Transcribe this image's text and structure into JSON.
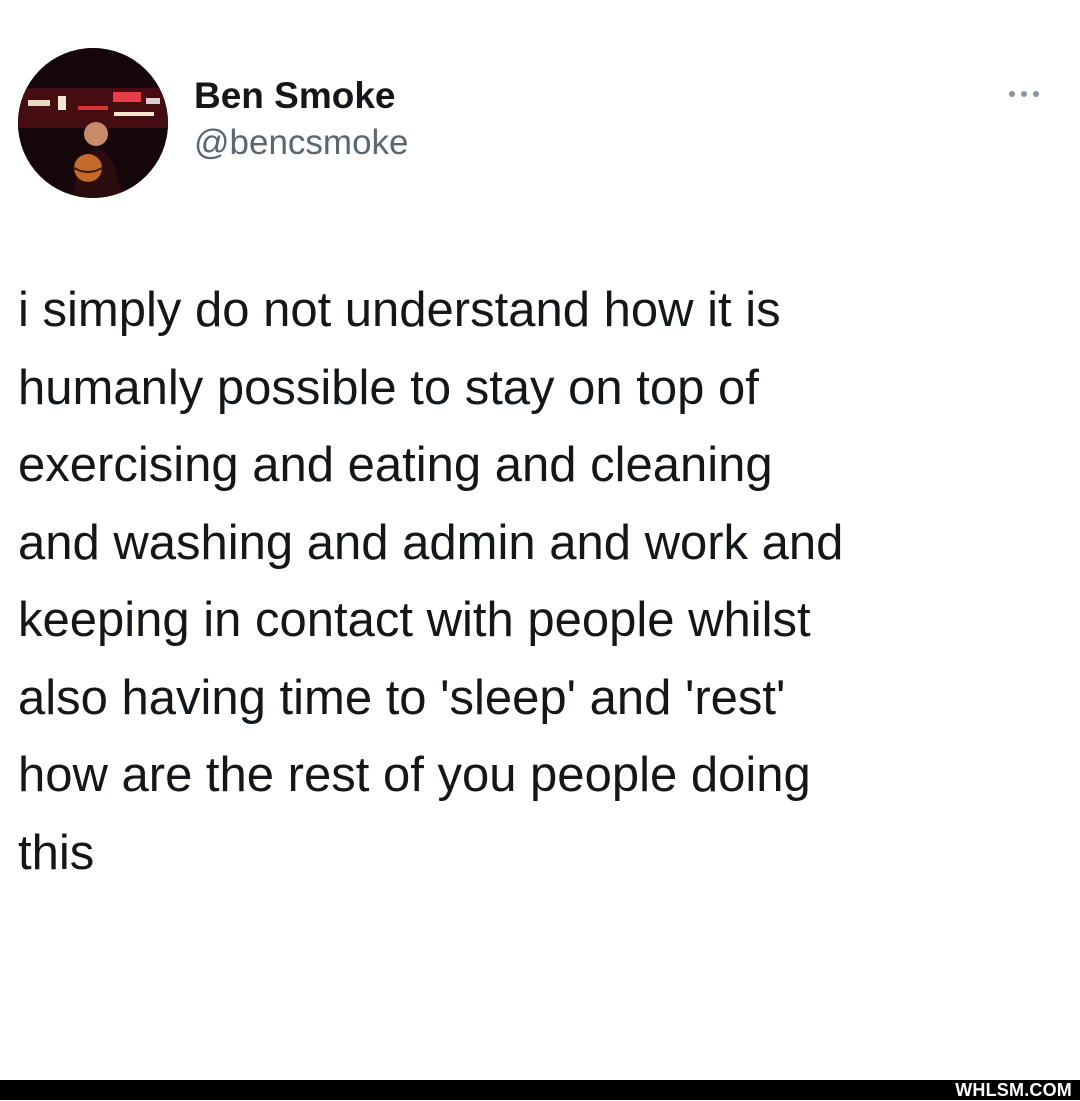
{
  "tweet": {
    "author_name": "Ben Smoke",
    "author_handle": "@bencsmoke",
    "more_icon": "more-horizontal-icon",
    "text_lines": [
      "i simply do not understand how it is",
      "humanly possible to stay on top of",
      "exercising and eating and cleaning",
      "and washing and admin and work and",
      "keeping in contact with people whilst",
      "also having time to 'sleep' and 'rest'",
      "how are the rest of you people doing",
      "this"
    ]
  },
  "footer": {
    "watermark": "WHLSM.COM"
  },
  "colors": {
    "background": "#ffffff",
    "text": "#14171a",
    "handle": "#5b6670",
    "footer_bar": "#000000"
  }
}
